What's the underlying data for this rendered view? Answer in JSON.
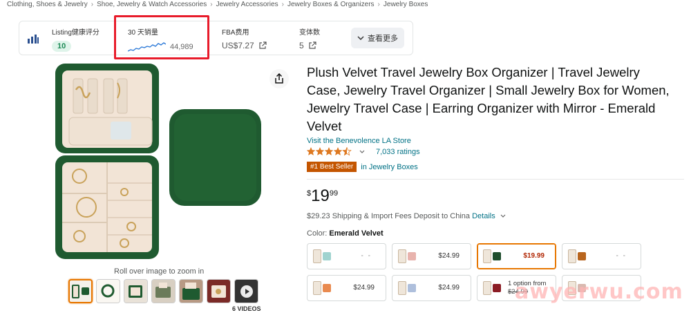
{
  "breadcrumb": [
    "Clothing, Shoes & Jewelry",
    "Shoe, Jewelry & Watch Accessories",
    "Jewelry Accessories",
    "Jewelry Boxes & Organizers",
    "Jewelry Boxes"
  ],
  "breadcrumb_sep": "›",
  "ext_bar": {
    "logo_icon": "bar-chart-icon",
    "listing_label": "Listing健康评分",
    "listing_score": "10",
    "sales_label": "30 天销量",
    "sales_value": "44,989",
    "fba_label": "FBA费用",
    "fba_value": "US$7.27",
    "variants_label": "变体数",
    "variants_value": "5",
    "more_label": "查看更多"
  },
  "gallery": {
    "zoom_hint": "Roll over image to zoom in",
    "videos_label": "6 VIDEOS"
  },
  "product": {
    "title": "Plush Velvet Travel Jewelry Box Organizer | Travel Jewelry Case, Jewelry Travel Organizer | Small Jewelry Box for Women, Jewelry Travel Case | Earring Organizer with Mirror - Emerald Velvet",
    "store_link": "Visit the Benevolence LA Store",
    "rating_stars": 4.5,
    "rating_count": "7,033 ratings",
    "best_seller_badge": "#1 Best Seller",
    "best_seller_category": "in Jewelry Boxes",
    "price_symbol": "$",
    "price_whole": "19",
    "price_fraction": "99",
    "shipping_text": "$29.23 Shipping & Import Fees Deposit to China",
    "shipping_details": "Details",
    "color_label": "Color:",
    "color_value": "Emerald Velvet"
  },
  "swatches": [
    {
      "color": "#9fd3cf",
      "price": "- -",
      "selected": false
    },
    {
      "color": "#e8b3ad",
      "price": "$24.99",
      "selected": false
    },
    {
      "color": "#1e4d2b",
      "price": "$19.99",
      "selected": true
    },
    {
      "color": "#b8651e",
      "price": "- -",
      "selected": false
    },
    {
      "color": "#e98a4f",
      "price": "$24.99",
      "selected": false
    },
    {
      "color": "#aebfdc",
      "price": "$24.99",
      "selected": false
    },
    {
      "color": "#8b1c24",
      "option_text": "1 option from",
      "price": "$24.99",
      "selected": false
    },
    {
      "color": "#d9b9b0",
      "price": "",
      "selected": false
    }
  ],
  "watermark": "awyerwu.com",
  "colors": {
    "accent_red": "#e81b2a",
    "link": "#007185",
    "star": "#de7921",
    "best_seller": "#c45500",
    "selected_outline": "#e77600",
    "emerald": "#1e5631"
  }
}
